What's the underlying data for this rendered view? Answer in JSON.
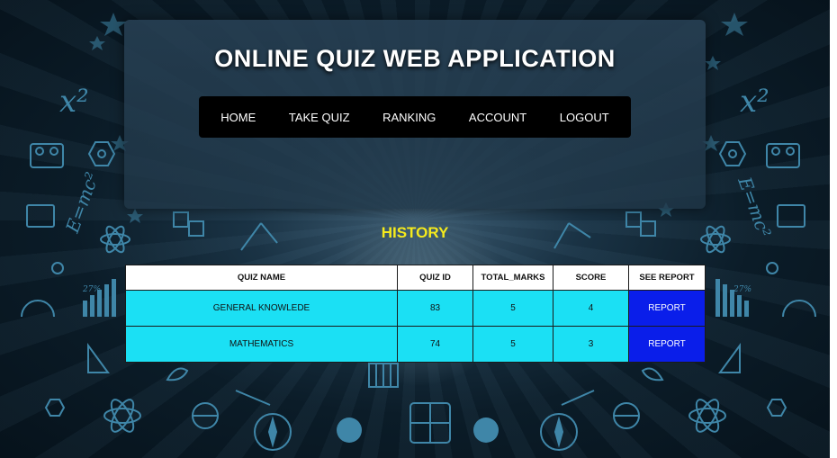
{
  "app": {
    "title": "ONLINE QUIZ WEB APPLICATION"
  },
  "nav": {
    "items": [
      {
        "label": "HOME"
      },
      {
        "label": "TAKE QUIZ"
      },
      {
        "label": "RANKING"
      },
      {
        "label": "ACCOUNT"
      },
      {
        "label": "LOGOUT"
      }
    ]
  },
  "history": {
    "heading": "HISTORY",
    "columns": [
      "QUIZ NAME",
      "QUIZ ID",
      "TOTAL_MARKS",
      "SCORE",
      "SEE REPORT"
    ],
    "rows": [
      {
        "quiz_name": "GENERAL KNOWLEDE",
        "quiz_id": "83",
        "total_marks": "5",
        "score": "4",
        "report": "REPORT"
      },
      {
        "quiz_name": "MATHEMATICS",
        "quiz_id": "74",
        "total_marks": "5",
        "score": "3",
        "report": "REPORT"
      }
    ]
  },
  "decor_text": {
    "x_squared_left": "x²",
    "x_squared_right": "x²",
    "emc2_left": "E=mc²",
    "emc2_right": "E=mc²",
    "percent_left": "27%",
    "percent_right": "27%"
  },
  "colors": {
    "title": "#ffffff",
    "heading": "#f5ea1c",
    "row_bg": "#1be0f4",
    "report_bg": "#0a1eea",
    "nav_bg": "#000000",
    "background": "#06121b",
    "icon": "#3f86a8"
  }
}
